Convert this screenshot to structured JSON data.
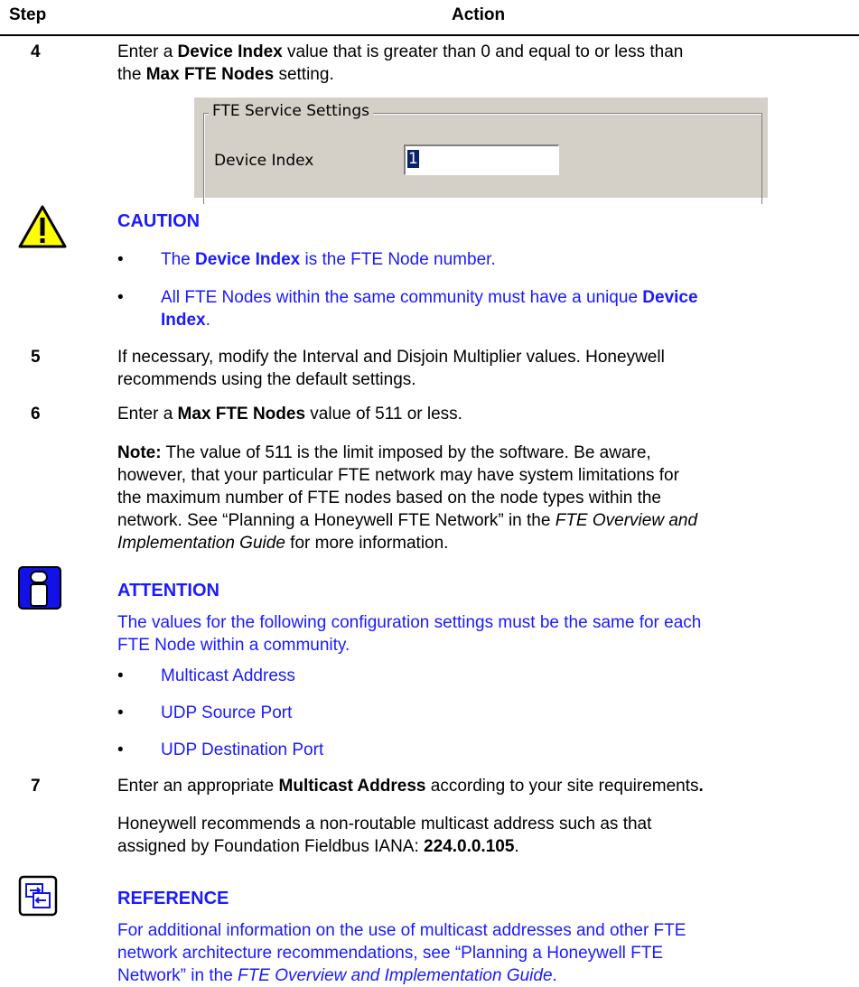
{
  "header": {
    "step_label": "Step",
    "action_label": "Action"
  },
  "steps": {
    "s4": {
      "number": "4",
      "line1_a": "Enter a ",
      "line1_b": "Device Index",
      "line1_c": " value that is greater than 0 and equal to or less than",
      "line2_a": "the ",
      "line2_b": "Max FTE Nodes",
      "line2_c": " setting."
    },
    "s5": {
      "number": "5",
      "line1": "If necessary, modify the Interval and Disjoin Multiplier values. Honeywell",
      "line2": "recommends using the default settings."
    },
    "s6": {
      "number": "6",
      "text_a": "Enter a ",
      "text_b": "Max FTE Nodes",
      "text_c": " value of 511 or less.",
      "note_label": "Note:",
      "note_l1": " The value of 511 is the limit imposed by the software. Be aware,",
      "note_l2": "however, that your particular FTE network may have system limitations for",
      "note_l3": "the maximum number of FTE nodes based on the node types within the",
      "note_l4": "network. See “Planning a Honeywell FTE Network” in the ",
      "note_italic1": "FTE Overview and",
      "note_italic2": "Implementation Guide",
      "note_l5": " for more information."
    },
    "s7": {
      "number": "7",
      "text_a": "Enter an appropriate ",
      "text_b": "Multicast Address",
      "text_c": " according to your site requirements",
      "text_d": ".",
      "rec_l1": "Honeywell recommends a non-routable multicast address such as that",
      "rec_l2": "assigned by Foundation Fieldbus IANA: ",
      "rec_addr": "224.0.0.105",
      "rec_end": "."
    }
  },
  "dialog": {
    "group_label": "FTE Service Settings",
    "field_label": "Device Index",
    "field_value": "1"
  },
  "caution": {
    "title": "CAUTION",
    "b1_a": "The ",
    "b1_b": "Device Index",
    "b1_c": " is the FTE Node number.",
    "b2_a": "All FTE Nodes within the same community must have a unique ",
    "b2_b": "Device",
    "b2_c": "Index",
    "b2_d": "."
  },
  "attention": {
    "title": "ATTENTION",
    "l1": "The values for the following configuration settings must be the same for each",
    "l2": "FTE Node within a community.",
    "items": [
      "Multicast Address",
      "UDP Source Port",
      "UDP Destination Port"
    ]
  },
  "reference": {
    "title": "REFERENCE",
    "l1": "For additional information on the use of multicast addresses and other FTE",
    "l2": "network architecture recommendations, see “Planning a Honeywell FTE",
    "l3": "Network” in the ",
    "l3_italic": "FTE Overview and Implementation Guide",
    "l3_end": "."
  },
  "bullet_char": "•",
  "colors": {
    "accent_blue": "#1a1aff",
    "caution_yellow": "#ffff00",
    "attention_blue": "#1212e6"
  }
}
